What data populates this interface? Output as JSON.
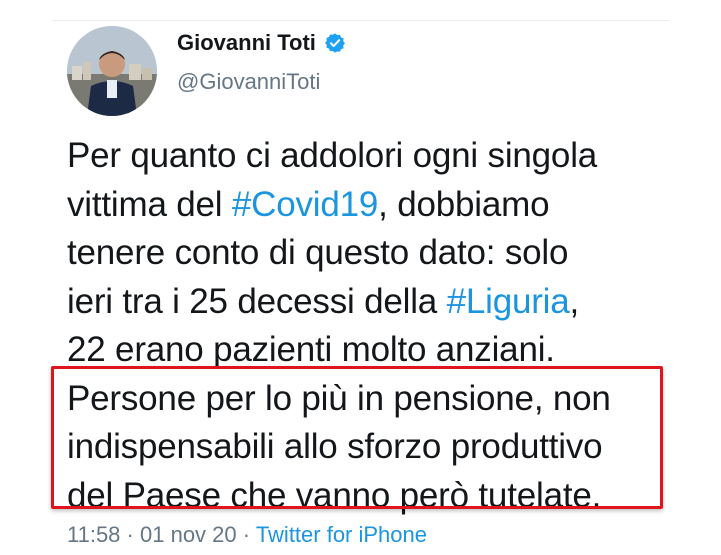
{
  "tweet": {
    "author": {
      "display_name": "Giovanni Toti",
      "handle": "@GiovanniToti",
      "verified_icon": "verified-badge-icon",
      "avatar": "avatar-photo"
    },
    "text_lines": [
      {
        "before": "Per quanto ci addolori ogni singola",
        "tag": "",
        "after": ""
      },
      {
        "before": "vittima del ",
        "tag": "#Covid19",
        "after": ", dobbiamo"
      },
      {
        "before": "tenere conto di questo dato: solo",
        "tag": "",
        "after": ""
      },
      {
        "before": "ieri tra i 25 decessi della ",
        "tag": "#Liguria",
        "after": ","
      },
      {
        "before": "22 erano pazienti molto anziani.",
        "tag": "",
        "after": ""
      },
      {
        "before": "Persone per lo più in pensione, non",
        "tag": "",
        "after": ""
      },
      {
        "before": "indispensabili allo sforzo produttivo",
        "tag": "",
        "after": ""
      },
      {
        "before": "del Paese che vanno però tutelate.",
        "tag": "",
        "after": ""
      }
    ],
    "meta": {
      "time": "11:58",
      "separator": "·",
      "date": "01 nov 20",
      "source": "Twitter for iPhone"
    }
  },
  "colors": {
    "link": "#1b95e0",
    "secondary_text": "#657786",
    "highlight_border": "#e0141c",
    "verified": "#1da1f2"
  }
}
